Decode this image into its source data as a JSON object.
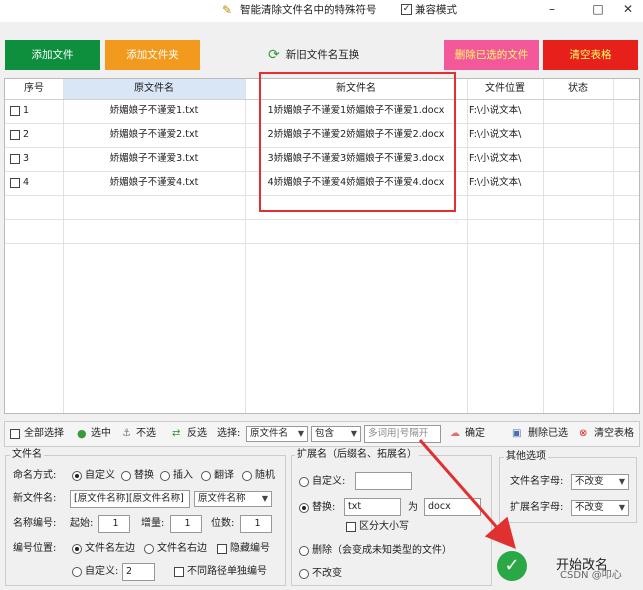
{
  "window": {
    "title": "智能清除文件名中的特殊符号",
    "compat_label": "兼容模式",
    "compat_checked": "✓",
    "min": "–",
    "max": "□",
    "close": "✕"
  },
  "buttons": {
    "add_file": "添加文件",
    "add_folder": "添加文件夹",
    "swap": "新旧文件名互换",
    "delete_selected": "删除已选的文件",
    "clear_table": "清空表格"
  },
  "table": {
    "headers": {
      "seq": "序号",
      "orig": "原文件名",
      "new": "新文件名",
      "loc": "文件位置",
      "status": "状态"
    },
    "rows": [
      {
        "seq": "1",
        "orig": "娇媚娘子不谨爱1.txt",
        "new": "1娇媚娘子不谨爱1娇媚娘子不谨爱1.docx",
        "loc": "F:\\小说文本\\",
        "status": ""
      },
      {
        "seq": "2",
        "orig": "娇媚娘子不谨爱2.txt",
        "new": "2娇媚娘子不谨爱2娇媚娘子不谨爱2.docx",
        "loc": "F:\\小说文本\\",
        "status": ""
      },
      {
        "seq": "3",
        "orig": "娇媚娘子不谨爱3.txt",
        "new": "3娇媚娘子不谨爱3娇媚娘子不谨爱3.docx",
        "loc": "F:\\小说文本\\",
        "status": ""
      },
      {
        "seq": "4",
        "orig": "娇媚娘子不谨爱4.txt",
        "new": "4娇媚娘子不谨爱4娇媚娘子不谨爱4.docx",
        "loc": "F:\\小说文本\\",
        "status": ""
      }
    ]
  },
  "toolbar": {
    "select_all": "全部选择",
    "select": "选中",
    "deselect": "不选",
    "invert": "反选",
    "choose": "选择:",
    "field": "原文件名",
    "mode": "包含",
    "keywords_placeholder": "多词用|号隔开",
    "confirm": "确定",
    "delete_selected": "删除已选",
    "clear_table": "清空表格"
  },
  "filename_group": {
    "legend": "文件名",
    "naming_label": "命名方式:",
    "opt_custom": "自定义",
    "opt_replace": "替换",
    "opt_insert": "插入",
    "opt_translate": "翻译",
    "opt_random": "随机",
    "new_name_label": "新文件名:",
    "new_name_value": "[原文件名称][原文件名称]",
    "new_name_select": "原文件名称",
    "numbering_label": "名称编号:",
    "start_label": "起始:",
    "start_value": "1",
    "step_label": "增量:",
    "step_value": "1",
    "digits_label": "位数:",
    "digits_value": "1",
    "position_label": "编号位置:",
    "pos_left": "文件名左边",
    "pos_right": "文件名右边",
    "hide_number": "隐藏编号",
    "pos_custom": "自定义:",
    "pos_custom_value": "2",
    "per_path": "不同路径单独编号"
  },
  "ext_group": {
    "legend": "扩展名（后缀名、拓展名）",
    "custom": "自定义:",
    "replace": "替换:",
    "replace_from": "txt",
    "to": "为",
    "replace_to": "docx",
    "case_sensitive": "区分大小写",
    "delete": "删除（会变成未知类型的文件）",
    "no_change": "不改变"
  },
  "other_group": {
    "legend": "其他选项",
    "filename_case_label": "文件名字母:",
    "filename_case_value": "不改变",
    "ext_case_label": "扩展名字母:",
    "ext_case_value": "不改变"
  },
  "start": {
    "label": "开始改名",
    "check": "✓"
  },
  "watermark": "CSDN @叩心",
  "colors": {
    "add_file": "#0e8f3e",
    "add_folder": "#f29a1e",
    "delete_selected": "#f3589a",
    "clear_table": "#e8201c",
    "highlight": "#e03030",
    "header_sel": "#d8e6f5"
  }
}
